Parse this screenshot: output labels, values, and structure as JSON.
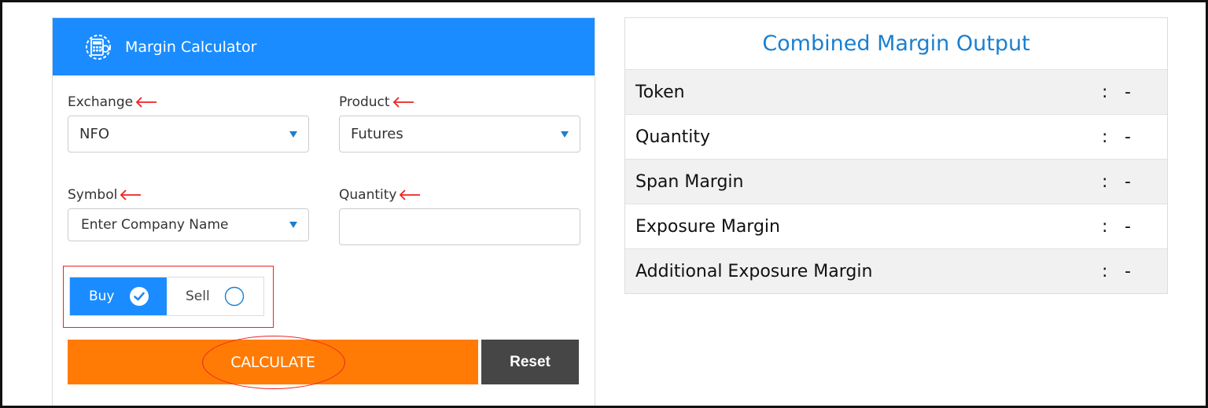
{
  "calculator": {
    "title": "Margin Calculator",
    "exchange": {
      "label": "Exchange",
      "value": "NFO"
    },
    "product": {
      "label": "Product",
      "value": "Futures"
    },
    "symbol": {
      "label": "Symbol",
      "placeholder": "Enter Company Name"
    },
    "quantity": {
      "label": "Quantity",
      "value": ""
    },
    "side": {
      "buy_label": "Buy",
      "sell_label": "Sell",
      "selected": "Buy"
    },
    "calculate_label": "CALCULATE",
    "reset_label": "Reset",
    "colors": {
      "header": "#1a8cff",
      "calculate": "#ff7b05",
      "reset": "#464646",
      "annotation": "#e22222"
    }
  },
  "output": {
    "title": "Combined Margin Output",
    "rows": [
      {
        "label": "Token",
        "sep": ":",
        "value": "-"
      },
      {
        "label": "Quantity",
        "sep": ":",
        "value": "-"
      },
      {
        "label": "Span Margin",
        "sep": ":",
        "value": "-"
      },
      {
        "label": "Exposure Margin",
        "sep": ":",
        "value": "-"
      },
      {
        "label": "Additional Exposure Margin",
        "sep": ":",
        "value": "-"
      }
    ]
  },
  "icons": [
    "calculator-gear-icon",
    "red-arrow-icon",
    "dropdown-caret-icon",
    "check-circle-icon",
    "radio-empty-icon"
  ]
}
